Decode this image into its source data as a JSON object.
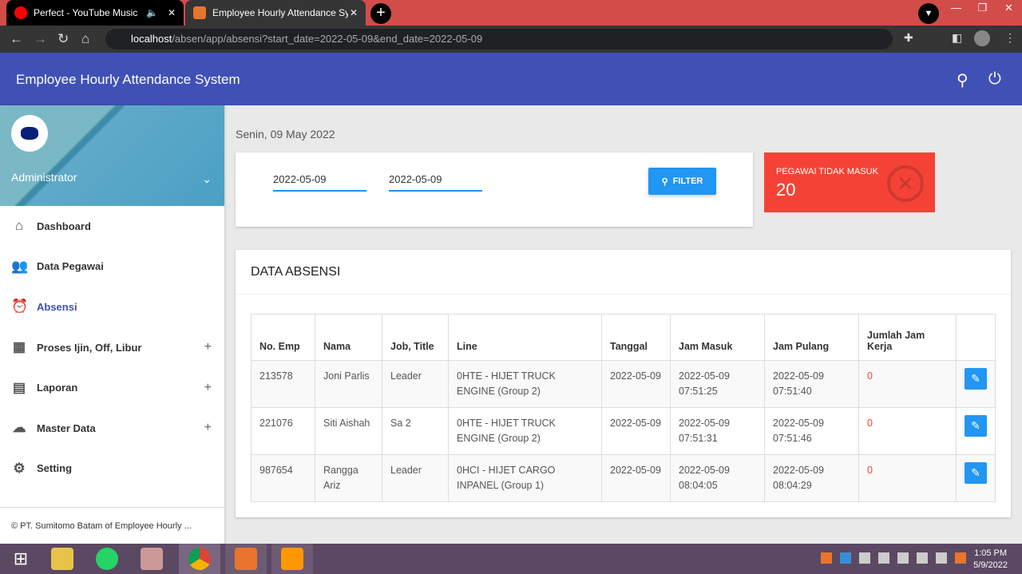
{
  "browser": {
    "tabs": [
      {
        "label": "Perfect - YouTube Music",
        "active": false
      },
      {
        "label": "Employee Hourly Attendance Sys",
        "active": true
      }
    ],
    "url_host": "localhost",
    "url_path": "/absen/app/absensi?start_date=2022-05-09&end_date=2022-05-09"
  },
  "app": {
    "title": "Employee Hourly Attendance System",
    "color": "#3f51b5"
  },
  "sidebar": {
    "user": "Administrator",
    "items": [
      {
        "label": "Dashboard",
        "icon": "home-icon",
        "ic": "⌂"
      },
      {
        "label": "Data Pegawai",
        "icon": "people-icon",
        "ic": "👥"
      },
      {
        "label": "Absensi",
        "icon": "alarm-icon",
        "ic": "⏰",
        "active": true
      },
      {
        "label": "Proses Ijin, Off, Libur",
        "icon": "calendar-icon",
        "ic": "▦",
        "expand": "+"
      },
      {
        "label": "Laporan",
        "icon": "clipboard-icon",
        "ic": "▤",
        "expand": "+"
      },
      {
        "label": "Master Data",
        "icon": "cloud-icon",
        "ic": "☁",
        "expand": "+"
      },
      {
        "label": "Setting",
        "icon": "gear-icon",
        "ic": "⚙"
      }
    ],
    "footer": "© PT. Sumitomo Batam of Employee Hourly ..."
  },
  "main": {
    "date": "Senin, 09 May 2022",
    "start_date": "2022-05-09",
    "end_date": "2022-05-09",
    "filter_label": "FILTER",
    "info": {
      "label": "PEGAWAI TIDAK MASUK",
      "value": "20",
      "color": "#f44336"
    },
    "table": {
      "title": "DATA ABSENSI",
      "columns": [
        "No. Emp",
        "Nama",
        "Job, Title",
        "Line",
        "Tanggal",
        "Jam Masuk",
        "Jam Pulang",
        "Jumlah Jam Kerja",
        ""
      ],
      "rows": [
        [
          "213578",
          "Joni Parlis",
          "Leader",
          "0HTE - HIJET TRUCK ENGINE (Group 2)",
          "2022-05-09",
          "2022-05-09 07:51:25",
          "2022-05-09 07:51:40",
          "0"
        ],
        [
          "221076",
          "Siti Aishah",
          "Sa 2",
          "0HTE - HIJET TRUCK ENGINE (Group 2)",
          "2022-05-09",
          "2022-05-09 07:51:31",
          "2022-05-09 07:51:46",
          "0"
        ],
        [
          "987654",
          "Rangga Ariz",
          "Leader",
          "0HCI - HIJET CARGO INPANEL (Group 1)",
          "2022-05-09",
          "2022-05-09 08:04:05",
          "2022-05-09 08:04:29",
          "0"
        ]
      ]
    }
  },
  "taskbar": {
    "time": "1:05 PM",
    "date": "5/9/2022"
  }
}
